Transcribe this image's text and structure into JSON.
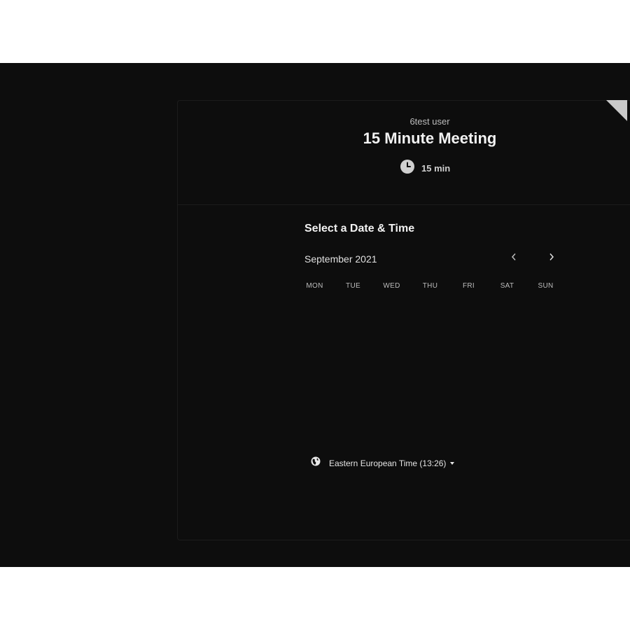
{
  "event": {
    "host_name": "6test user",
    "title": "15 Minute Meeting",
    "duration": "15 min"
  },
  "picker": {
    "section_title": "Select a Date & Time",
    "month": "September 2021",
    "weekdays": [
      "MON",
      "TUE",
      "WED",
      "THU",
      "FRI",
      "SAT",
      "SUN"
    ]
  },
  "timezone": {
    "label": "Eastern European Time (13:26)"
  },
  "icons": {
    "duration": "clock-icon",
    "timezone": "globe-icon",
    "prev": "chevron-left-icon",
    "next": "chevron-right-icon",
    "dropdown": "caret-down-icon"
  },
  "colors": {
    "background": "#0d0d0d",
    "text_primary": "#f2f2f2",
    "text_secondary": "#bdbdbd",
    "corner_badge": "#c9c9c9"
  }
}
